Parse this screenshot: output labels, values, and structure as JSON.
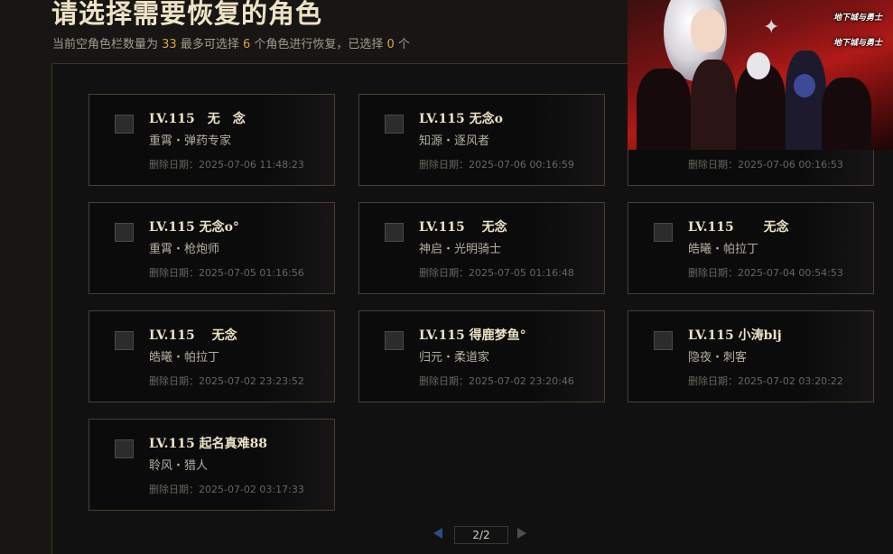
{
  "header": {
    "title": "请选择需要恢复的角色",
    "subtitle_parts": {
      "prefix": "当前空角色栏数量为 ",
      "empty_slots": "33",
      "mid1": " 最多可选择 ",
      "max_select": "6",
      "mid2": " 个角色进行恢复，已选择 ",
      "selected": "0",
      "suffix": " 个"
    }
  },
  "banner": {
    "logo_text_1": "地下城与勇士",
    "logo_text_2": "地下城与勇士"
  },
  "characters": [
    {
      "name": "LV.115　无　念",
      "job": "重霄・弹药专家",
      "date": "删除日期：2025-07-06 11:48:23"
    },
    {
      "name": "LV.115 无念o",
      "job": "知源・逐风者",
      "date": "删除日期：2025-07-06 00:16:59"
    },
    {
      "name": "",
      "job": "",
      "date": "删除日期：2025-07-06 00:16:53"
    },
    {
      "name": "LV.115 无念o°",
      "job": "重霄・枪炮师",
      "date": "删除日期：2025-07-05 01:16:56"
    },
    {
      "name": "LV.115　 无念",
      "job": "神启・光明骑士",
      "date": "删除日期：2025-07-05 01:16:48"
    },
    {
      "name": "LV.115　　 无念",
      "job": "皓曦・帕拉丁",
      "date": "删除日期：2025-07-04 00:54:53"
    },
    {
      "name": "LV.115　 无念",
      "job": "皓曦・帕拉丁",
      "date": "删除日期：2025-07-02 23:23:52"
    },
    {
      "name": "LV.115 得鹿梦鱼°",
      "job": "归元・柔道家",
      "date": "删除日期：2025-07-02 23:20:46"
    },
    {
      "name": "LV.115 小涛blj",
      "job": "隐夜・刺客",
      "date": "删除日期：2025-07-02 03:20:22"
    },
    {
      "name": "LV.115 起名真难88",
      "job": "聆风・猎人",
      "date": "删除日期：2025-07-02 03:17:33"
    }
  ],
  "pagination": {
    "page_label": "2/2",
    "prev_icon": "arrow-left-icon",
    "next_icon": "arrow-right-icon"
  },
  "colors": {
    "accent_number": "#d9a441",
    "card_border": "#4b4030",
    "prev_arrow": "#2e4a86"
  }
}
